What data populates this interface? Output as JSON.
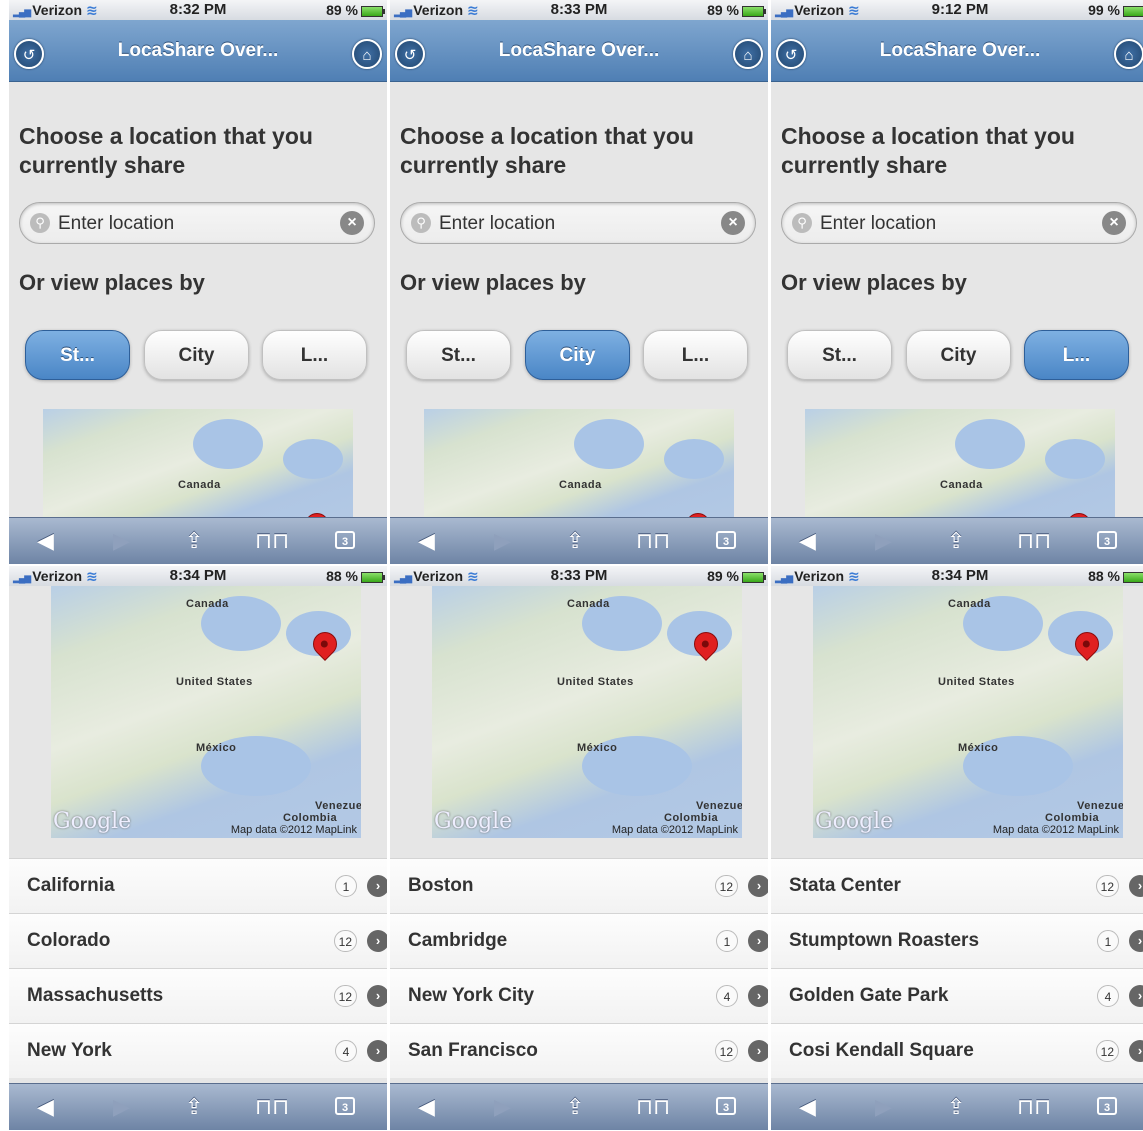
{
  "screens": [
    {
      "status": {
        "carrier": "Verizon",
        "time": "8:32 PM",
        "battery": "89 %"
      },
      "header": {
        "title": "LocaShare Over..."
      },
      "heading": "Choose a location that you currently share",
      "search": {
        "placeholder": "Enter location"
      },
      "subheading": "Or view places by",
      "segments": [
        "St...",
        "City",
        "L..."
      ],
      "active_segment": 0,
      "map_label": "Canada",
      "toolbar": {
        "tabs_count": "3"
      }
    },
    {
      "status": {
        "carrier": "Verizon",
        "time": "8:33 PM",
        "battery": "89 %"
      },
      "header": {
        "title": "LocaShare Over..."
      },
      "heading": "Choose a location that you currently share",
      "search": {
        "placeholder": "Enter location"
      },
      "subheading": "Or view places by",
      "segments": [
        "St...",
        "City",
        "L..."
      ],
      "active_segment": 1,
      "map_label": "Canada",
      "toolbar": {
        "tabs_count": "3"
      }
    },
    {
      "status": {
        "carrier": "Verizon",
        "time": "9:12 PM",
        "battery": "99 %"
      },
      "header": {
        "title": "LocaShare Over..."
      },
      "heading": "Choose a location that you currently share",
      "search": {
        "placeholder": "Enter location"
      },
      "subheading": "Or view places by",
      "segments": [
        "St...",
        "City",
        "L..."
      ],
      "active_segment": 2,
      "map_label": "Canada",
      "toolbar": {
        "tabs_count": "3"
      }
    },
    {
      "status": {
        "carrier": "Verizon",
        "time": "8:34 PM",
        "battery": "88 %"
      },
      "map": {
        "labels": [
          "Canada",
          "United States",
          "México",
          "Venezue",
          "Colombia"
        ],
        "google": "Google",
        "copyright": "Map data ©2012 MapLink"
      },
      "list": [
        {
          "name": "California",
          "count": "1"
        },
        {
          "name": "Colorado",
          "count": "12"
        },
        {
          "name": "Massachusetts",
          "count": "12"
        },
        {
          "name": "New York",
          "count": "4"
        }
      ],
      "toolbar": {
        "tabs_count": "3"
      }
    },
    {
      "status": {
        "carrier": "Verizon",
        "time": "8:33 PM",
        "battery": "89 %"
      },
      "map": {
        "labels": [
          "Canada",
          "United States",
          "México",
          "Venezue",
          "Colombia"
        ],
        "google": "Google",
        "copyright": "Map data ©2012 MapLink"
      },
      "list": [
        {
          "name": "Boston",
          "count": "12"
        },
        {
          "name": "Cambridge",
          "count": "1"
        },
        {
          "name": "New York City",
          "count": "4"
        },
        {
          "name": "San Francisco",
          "count": "12"
        }
      ],
      "toolbar": {
        "tabs_count": "3"
      }
    },
    {
      "status": {
        "carrier": "Verizon",
        "time": "8:34 PM",
        "battery": "88 %"
      },
      "map": {
        "labels": [
          "Canada",
          "United States",
          "México",
          "Venezue",
          "Colombia"
        ],
        "google": "Google",
        "copyright": "Map data ©2012 MapLink"
      },
      "list": [
        {
          "name": "Stata Center",
          "count": "12"
        },
        {
          "name": "Stumptown Roasters",
          "count": "1"
        },
        {
          "name": "Golden Gate Park",
          "count": "4"
        },
        {
          "name": "Cosi Kendall Square",
          "count": "12"
        }
      ],
      "toolbar": {
        "tabs_count": "3"
      }
    }
  ]
}
